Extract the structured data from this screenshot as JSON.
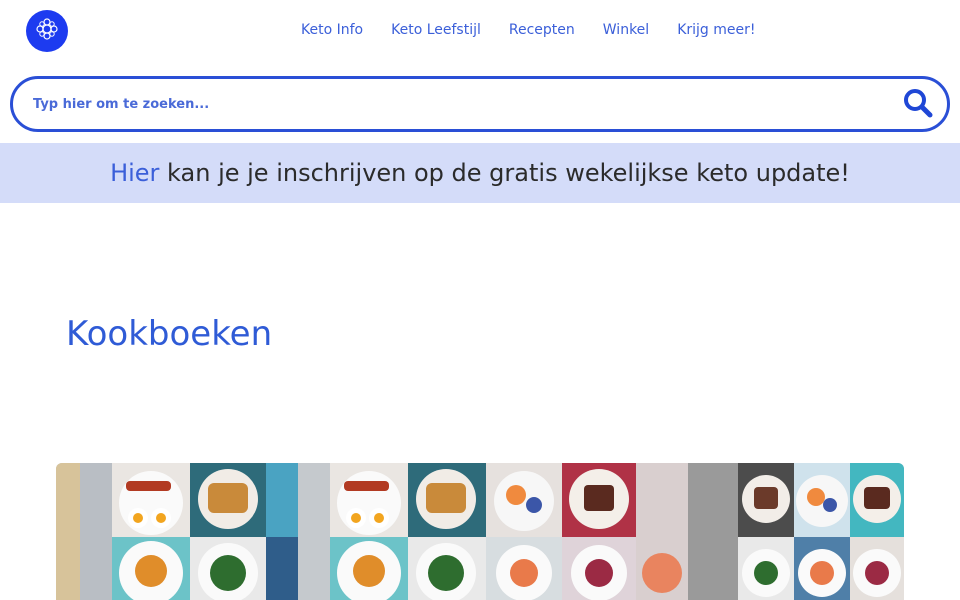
{
  "header": {
    "logo_icon": "sun-circle-logo-icon",
    "nav": [
      "Keto Info",
      "Keto Leefstijl",
      "Recepten",
      "Winkel",
      "Krijg meer!"
    ]
  },
  "search": {
    "placeholder": "Typ hier om te zoeken...",
    "button_icon": "search-icon"
  },
  "banner": {
    "link_text": "Hier",
    "text": " kan je je inschrijven op de gratis wekelijkse keto update!"
  },
  "main": {
    "title": "Kookboeken",
    "hero_image": "keto-food-collage-image"
  },
  "colors": {
    "accent": "#2f5bd6",
    "banner_bg": "#d4dcf9",
    "logo_bg": "#1d3bf0"
  }
}
